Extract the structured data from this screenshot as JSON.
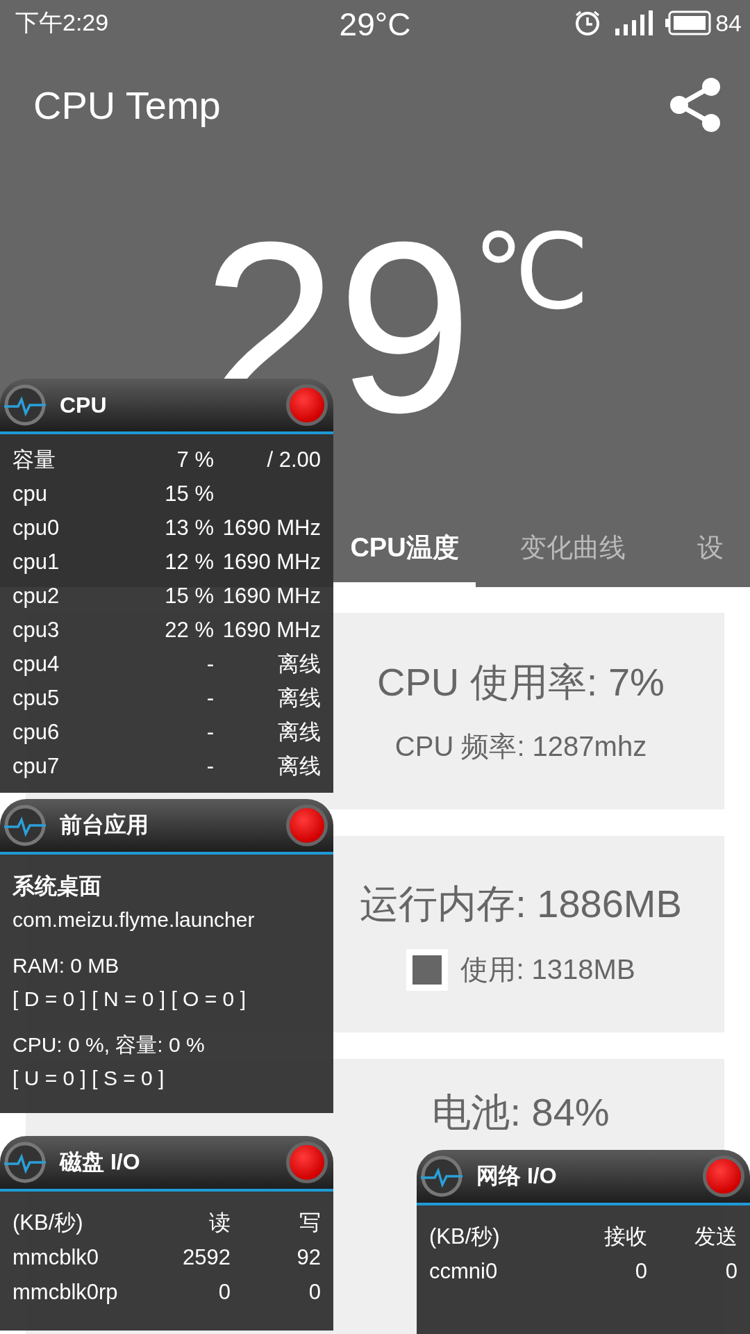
{
  "status_bar": {
    "time": "下午2:29",
    "temperature": "29°C",
    "battery": "84"
  },
  "app_bar": {
    "title": "CPU Temp"
  },
  "temperature": {
    "value": "29",
    "unit": "℃"
  },
  "tabs": [
    {
      "label": "CPU温度",
      "selected": true
    },
    {
      "label": "变化曲线",
      "selected": false
    },
    {
      "label": "设",
      "selected": false
    }
  ],
  "cards": [
    {
      "kind": "cpu",
      "title": "CPU 使用率: 7%",
      "detail": "CPU 频率: 1287mhz"
    },
    {
      "kind": "memory",
      "title": "运行内存: 1886MB",
      "detail": "使用: 1318MB"
    },
    {
      "kind": "battery",
      "title": "电池: 84%"
    }
  ],
  "widgets": [
    {
      "kind": "cpu",
      "title": "CPU",
      "rows": [
        [
          "容量",
          "7 %",
          "/ 2.00"
        ],
        [
          "cpu",
          "15 %",
          ""
        ],
        [
          "cpu0",
          "13 %",
          "1690 MHz"
        ],
        [
          "cpu1",
          "12 %",
          "1690 MHz"
        ],
        [
          "cpu2",
          "15 %",
          "1690 MHz"
        ],
        [
          "cpu3",
          "22 %",
          "1690 MHz"
        ],
        [
          "cpu4",
          "-",
          "离线"
        ],
        [
          "cpu5",
          "-",
          "离线"
        ],
        [
          "cpu6",
          "-",
          "离线"
        ],
        [
          "cpu7",
          "-",
          "离线"
        ]
      ]
    },
    {
      "kind": "foreground",
      "title": "前台应用",
      "app_name": "系统桌面",
      "package": "com.meizu.flyme.launcher",
      "sections": [
        [
          "RAM: 0 MB",
          "[ D = 0 ] [ N = 0 ] [ O = 0 ]"
        ],
        [
          "CPU: 0 %, 容量: 0 %",
          "[ U = 0 ] [ S = 0 ]"
        ]
      ]
    },
    {
      "kind": "disk",
      "title": "磁盘 I/O",
      "columns": [
        "(KB/秒)",
        "读",
        "写"
      ],
      "rows": [
        [
          "mmcblk0",
          "2592",
          "92"
        ],
        [
          "mmcblk0rp",
          "0",
          "0"
        ]
      ]
    },
    {
      "kind": "network",
      "title": "网络 I/O",
      "columns": [
        "(KB/秒)",
        "接收",
        "发送"
      ],
      "rows": [
        [
          "ccmni0",
          "0",
          "0"
        ]
      ]
    }
  ]
}
